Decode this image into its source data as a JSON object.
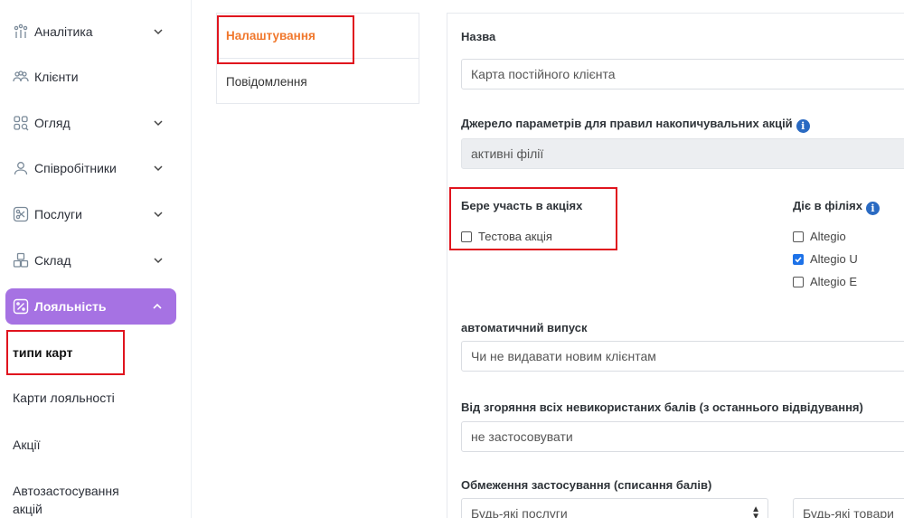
{
  "sidebar": {
    "items": [
      {
        "label": "Аналітика",
        "icon": "analytics-icon"
      },
      {
        "label": "Клієнти",
        "icon": "clients-icon"
      },
      {
        "label": "Огляд",
        "icon": "overview-icon"
      },
      {
        "label": "Співробітники",
        "icon": "user-icon"
      },
      {
        "label": "Послуги",
        "icon": "scissors-icon"
      },
      {
        "label": "Склад",
        "icon": "warehouse-icon"
      },
      {
        "label": "Лояльність",
        "icon": "percent-icon"
      }
    ],
    "sub_items": [
      {
        "label": "типи карт"
      },
      {
        "label": "Карти лояльності"
      },
      {
        "label": "Акції"
      },
      {
        "label": "Автозастосування акцій"
      }
    ],
    "active_color": "#a672e3"
  },
  "tabs": [
    {
      "label": "Налаштування"
    },
    {
      "label": "Повідомлення"
    }
  ],
  "form": {
    "name_label": "Назва",
    "name_value": "Карта постійного клієнта",
    "source_label": "Джерело параметрів для правил накопичувальних акцій",
    "source_value": "активні філії",
    "promos_label": "Бере участь в акціях",
    "promos": [
      {
        "label": "Тестова акція",
        "checked": false
      }
    ],
    "branches_label": "Діє в філіях",
    "branches": [
      {
        "label": "Altegio",
        "checked": false
      },
      {
        "label": "Altegio U",
        "checked": true
      },
      {
        "label": "Altegio E",
        "checked": false
      }
    ],
    "auto_issue_label": "автоматичний випуск",
    "auto_issue_value": "Чи не видавати новим клієнтам",
    "burn_label": "Від згоряння всіх невикористаних балів (з останнього відвідування)",
    "burn_value": "не застосовувати",
    "limit_label": "Обмеження застосування (списання балів)",
    "limit_services": "Будь-які послуги",
    "limit_goods": "Будь-які товари"
  },
  "colors": {
    "accent_orange": "#f0782d",
    "highlight_red": "#e0141e",
    "checkbox_blue": "#1d72e8",
    "info_blue": "#2a6ac2"
  }
}
